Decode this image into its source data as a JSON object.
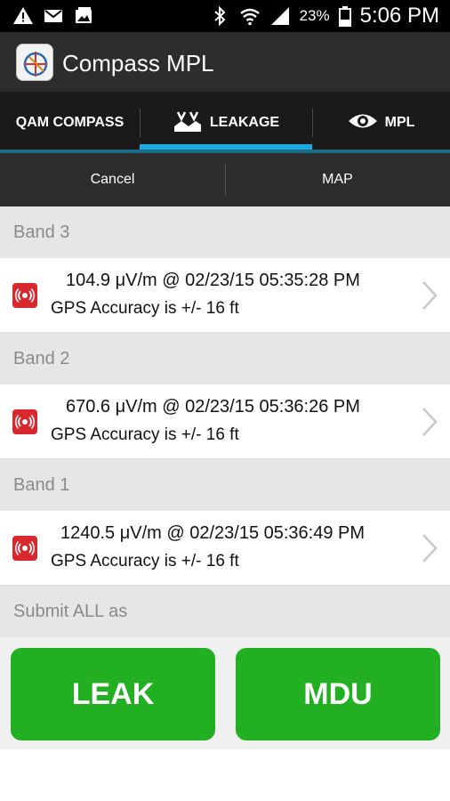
{
  "status_bar": {
    "icons_left": [
      "warning-icon",
      "mail-icon",
      "image-icon"
    ],
    "icons_right": [
      "bluetooth-icon",
      "wifi-icon",
      "signal-icon",
      "battery-icon"
    ],
    "battery_percent": "23%",
    "time": "5:06 PM"
  },
  "app": {
    "title": "Compass MPL",
    "logo_icon": "compass-logo-icon"
  },
  "tabs": [
    {
      "label": "QAM COMPASS",
      "icon": "",
      "selected": false
    },
    {
      "label": "LEAKAGE",
      "icon": "leakage-icon",
      "selected": true
    },
    {
      "label": "MPL",
      "icon": "eye-icon",
      "selected": false
    }
  ],
  "sub_actions": {
    "cancel_label": "Cancel",
    "map_label": "MAP"
  },
  "sections": [
    {
      "header": "Band 3",
      "item": {
        "reading": "104.9 μV/m @ 02/23/15 05:35:28 PM",
        "gps": "GPS Accuracy is +/- 16 ft",
        "icon": "leak-signal-icon"
      }
    },
    {
      "header": "Band 2",
      "item": {
        "reading": "670.6 μV/m @ 02/23/15 05:36:26 PM",
        "gps": "GPS Accuracy is +/- 16 ft",
        "icon": "leak-signal-icon"
      }
    },
    {
      "header": "Band 1",
      "item": {
        "reading": "1240.5 μV/m @ 02/23/15 05:36:49 PM",
        "gps": "GPS Accuracy is +/- 16 ft",
        "icon": "leak-signal-icon"
      }
    }
  ],
  "submit": {
    "header": "Submit ALL as",
    "leak_label": "LEAK",
    "mdu_label": "MDU"
  },
  "colors": {
    "accent_blue": "#1fa9de",
    "button_green": "#22b022",
    "icon_red": "#d9272e"
  }
}
